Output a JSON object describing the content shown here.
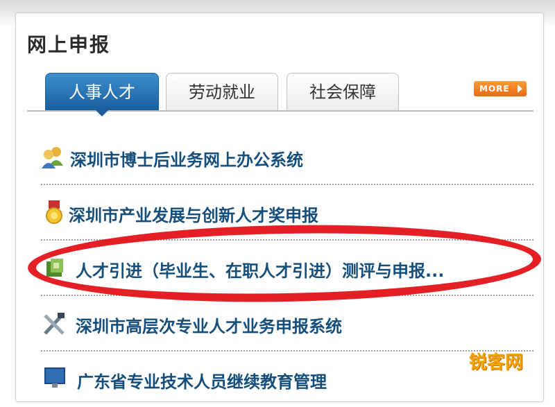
{
  "panel": {
    "title": "网上申报"
  },
  "tabs": [
    {
      "label": "人事人才",
      "active": true
    },
    {
      "label": "劳动就业",
      "active": false
    },
    {
      "label": "社会保障",
      "active": false
    }
  ],
  "more_label": "MORE",
  "items": [
    {
      "label": "深圳市博士后业务网上办公系统",
      "icon": "people-group-icon"
    },
    {
      "label": "深圳市产业发展与创新人才奖申报",
      "icon": "medal-icon"
    },
    {
      "label": "人才引进（毕业生、在职人才引进）测评与申报...",
      "icon": "green-leaf-icon"
    },
    {
      "label": "深圳市高层次专业人才业务申报系统",
      "icon": "tools-icon"
    },
    {
      "label": "广东省专业技术人员继续教育管理",
      "icon": "monitor-icon"
    }
  ],
  "watermark": "锐客网",
  "colors": {
    "active_tab": "#1a5e9e",
    "link": "#154e7a",
    "more_button": "#e86a10",
    "highlight": "#e3141a",
    "watermark": "#f2a400"
  }
}
